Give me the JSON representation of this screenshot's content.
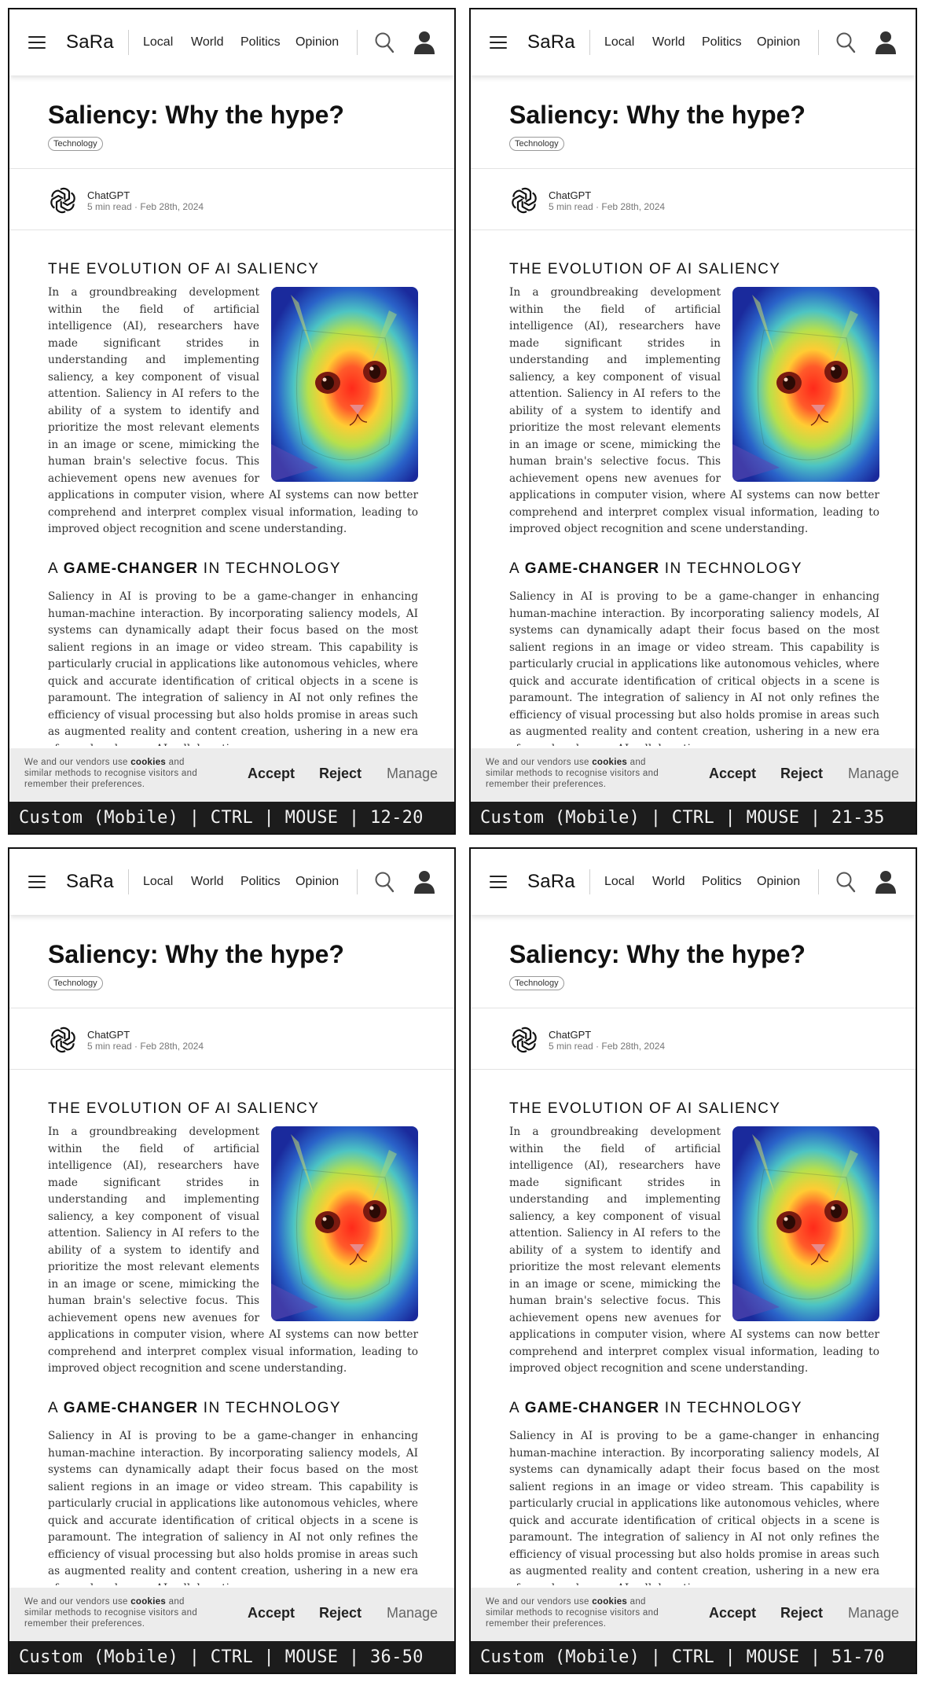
{
  "app": {
    "logo": "SaRa",
    "nav": [
      "Local",
      "World",
      "Politics",
      "Opinion"
    ]
  },
  "article": {
    "title": "Saliency: Why the hype?",
    "tag": "Technology",
    "author": "ChatGPT",
    "meta": "5 min read · Feb 28th, 2024",
    "section1_heading": "THE EVOLUTION OF AI SALIENCY",
    "section1_body": "In a groundbreaking development within the field of artificial intelligence (AI), researchers have made significant strides in understanding and implementing saliency, a key component of visual attention. Saliency in AI refers to the ability of a system to identify and prioritize the most relevant elements in an image or scene, mimicking the human brain's selective focus. This achievement opens new avenues for applications in computer vision, where AI systems can now better comprehend and interpret complex visual information, leading to improved object recognition and scene understanding.",
    "section2_heading_pre": "A ",
    "section2_heading_bold": "GAME-CHANGER",
    "section2_heading_post": " IN TECHNOLOGY",
    "section2_body": "Saliency in AI is proving to be a game-changer in enhancing human-machine interaction. By incorporating saliency models, AI systems can dynamically adapt their focus based on the most salient regions in an image or video stream. This capability is particularly crucial in applications like autonomous vehicles, where quick and accurate identification of critical objects in a scene is paramount. The integration of saliency in AI not only refines the efficiency of visual processing but also holds promise in areas such as augmented reality and content creation, ushering in a new era of seamless human-AI collaboration.",
    "image_icon": "cat-saliency-heatmap"
  },
  "cookie": {
    "text_pre": "We and our vendors use ",
    "text_bold": "cookies",
    "text_post": " and similar methods to recognise visitors and remember their preferences.",
    "accept": "Accept",
    "reject": "Reject",
    "manage": "Manage"
  },
  "panels": [
    {
      "status": "Custom (Mobile) | CTRL | MOUSE | 12-20"
    },
    {
      "status": "Custom (Mobile) | CTRL | MOUSE | 21-35"
    },
    {
      "status": "Custom (Mobile) | CTRL | MOUSE | 36-50"
    },
    {
      "status": "Custom (Mobile) | CTRL | MOUSE | 51-70"
    }
  ],
  "colors": {
    "status_bg": "#1c1c1c",
    "cookie_bg": "#ececec",
    "text": "#333333"
  }
}
